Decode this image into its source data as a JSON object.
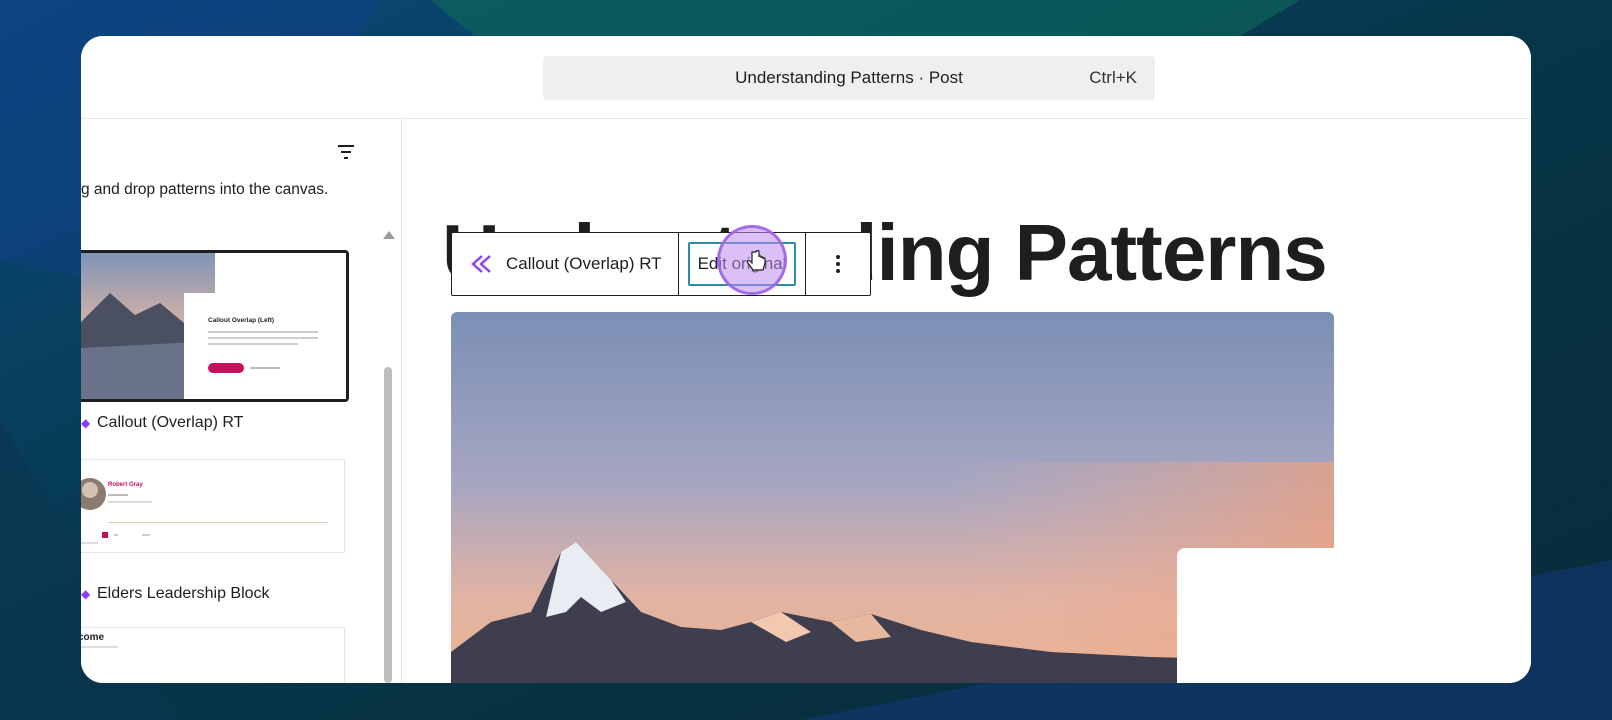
{
  "command_bar": {
    "title": "Understanding Patterns · Post",
    "shortcut": "Ctrl+K"
  },
  "sidebar": {
    "description": "g and drop patterns into the canvas.",
    "filter_icon": "filter-icon",
    "patterns": [
      {
        "label": "Callout (Overlap) RT",
        "thumb_title": "Callout Overlap (Left)",
        "selected": true
      },
      {
        "label": "Elders Leadership Block",
        "thumb_title": "Robert Gray",
        "selected": false
      },
      {
        "label": "",
        "thumb_title": "come",
        "selected": false
      }
    ]
  },
  "canvas": {
    "heading": "Understanding Patterns"
  },
  "block_toolbar": {
    "block_name": "Callout (Overlap) RT",
    "block_icon": "synced-pattern-icon",
    "edit_label": "Edit original",
    "more_icon": "more-vertical-icon"
  },
  "colors": {
    "accent": "#2d8da7",
    "pattern_icon": "#8a3ffc",
    "cursor_highlight": "#be8cf0"
  }
}
